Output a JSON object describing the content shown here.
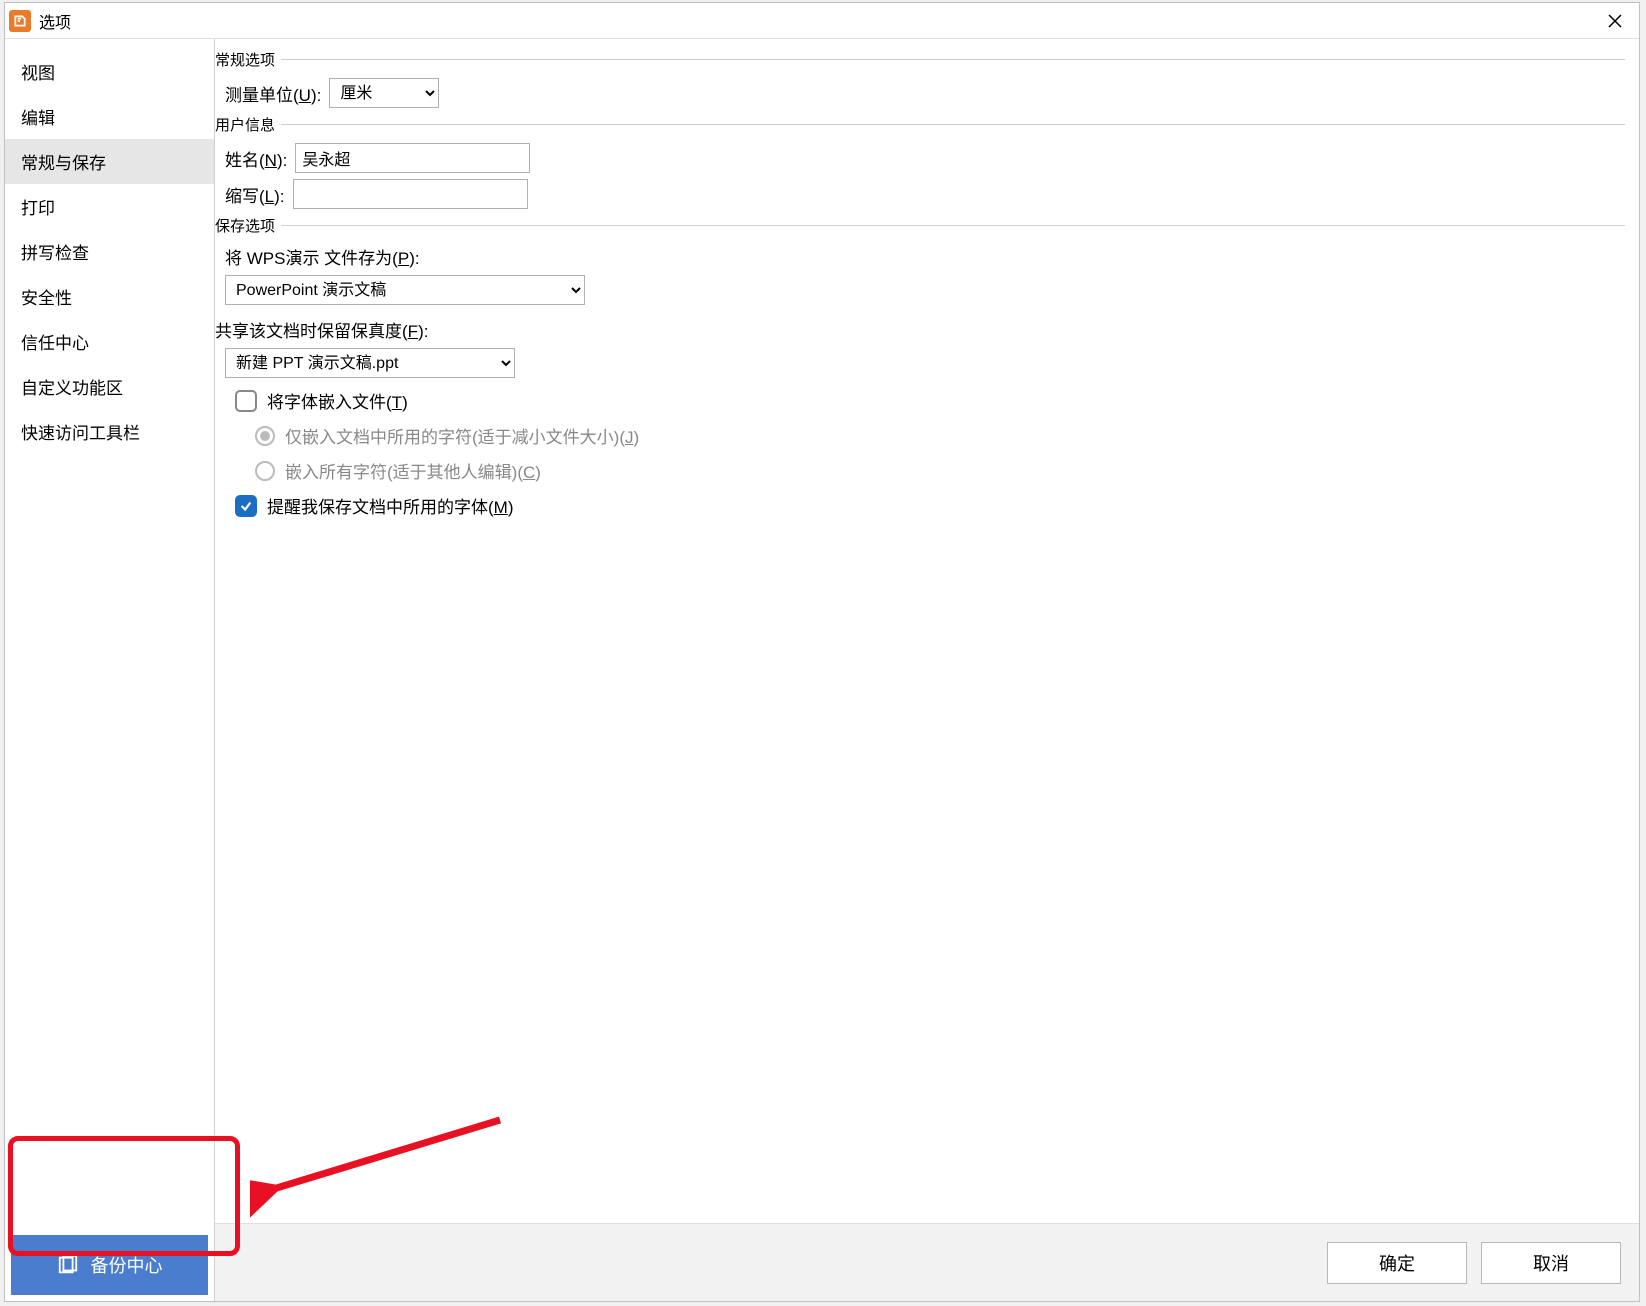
{
  "titlebar": {
    "title": "选项"
  },
  "sidebar": {
    "items": [
      {
        "label": "视图"
      },
      {
        "label": "编辑"
      },
      {
        "label": "常规与保存"
      },
      {
        "label": "打印"
      },
      {
        "label": "拼写检查"
      },
      {
        "label": "安全性"
      },
      {
        "label": "信任中心"
      },
      {
        "label": "自定义功能区"
      },
      {
        "label": "快速访问工具栏"
      }
    ],
    "active_index": 2,
    "backup_label": "备份中心"
  },
  "general": {
    "legend": "常规选项",
    "unit_label_pre": "测量单位(",
    "unit_key": "U",
    "unit_label_post": "):",
    "unit_value": "厘米"
  },
  "user": {
    "legend": "用户信息",
    "name_label_pre": "姓名(",
    "name_key": "N",
    "name_label_post": "):",
    "name_value": "吴永超",
    "initials_label_pre": "缩写(",
    "initials_key": "L",
    "initials_label_post": "):",
    "initials_value": ""
  },
  "save": {
    "legend": "保存选项",
    "saveas_label_pre": "将 WPS演示 文件存为(",
    "saveas_key": "P",
    "saveas_label_post": "):",
    "saveas_value": "PowerPoint 演示文稿",
    "fidelity_label_pre": "共享该文档时保留保真度(",
    "fidelity_key": "F",
    "fidelity_label_post": "):",
    "fidelity_doc": "新建 PPT 演示文稿.ppt",
    "embed_label_pre": "将字体嵌入文件(",
    "embed_key": "T",
    "embed_label_post": ")",
    "embed_checked": false,
    "embed_opt1_pre": "仅嵌入文档中所用的字符(适于减小文件大小)(",
    "embed_opt1_key": "J",
    "embed_opt1_post": ")",
    "embed_opt2_pre": "嵌入所有字符(适于其他人编辑)(",
    "embed_opt2_key": "C",
    "embed_opt2_post": ")",
    "remind_label_pre": "提醒我保存文档中所用的字体(",
    "remind_key": "M",
    "remind_label_post": ")",
    "remind_checked": true
  },
  "footer": {
    "ok": "确定",
    "cancel": "取消"
  }
}
